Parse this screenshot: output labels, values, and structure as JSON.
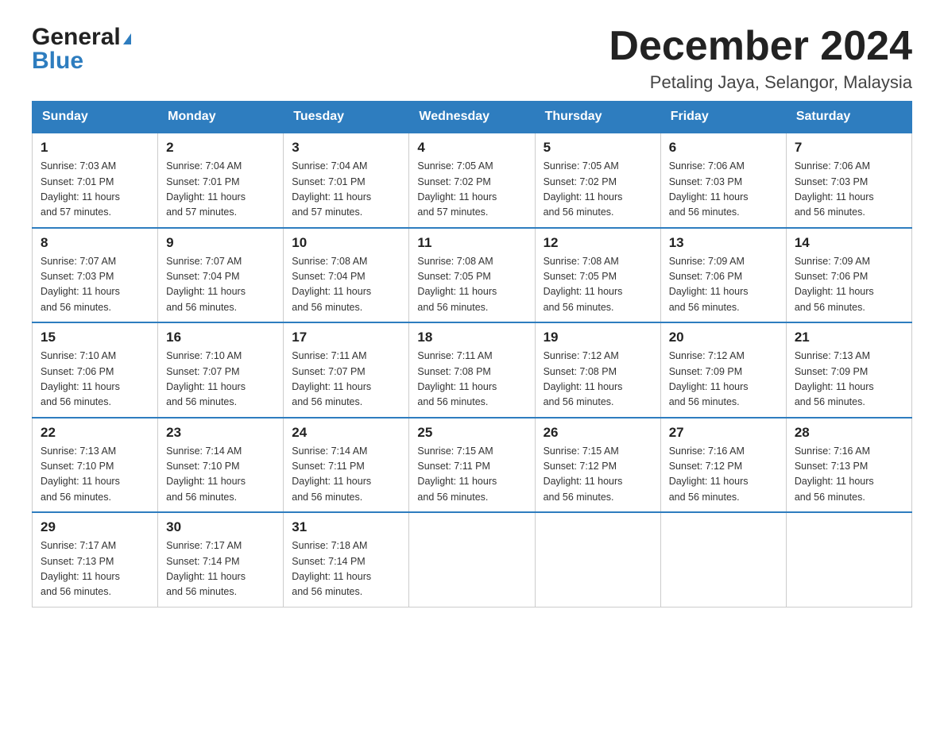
{
  "header": {
    "logo_general": "General",
    "logo_blue": "Blue",
    "month_title": "December 2024",
    "location": "Petaling Jaya, Selangor, Malaysia"
  },
  "days_of_week": [
    "Sunday",
    "Monday",
    "Tuesday",
    "Wednesday",
    "Thursday",
    "Friday",
    "Saturday"
  ],
  "weeks": [
    [
      {
        "day": "1",
        "sunrise": "7:03 AM",
        "sunset": "7:01 PM",
        "daylight": "11 hours and 57 minutes."
      },
      {
        "day": "2",
        "sunrise": "7:04 AM",
        "sunset": "7:01 PM",
        "daylight": "11 hours and 57 minutes."
      },
      {
        "day": "3",
        "sunrise": "7:04 AM",
        "sunset": "7:01 PM",
        "daylight": "11 hours and 57 minutes."
      },
      {
        "day": "4",
        "sunrise": "7:05 AM",
        "sunset": "7:02 PM",
        "daylight": "11 hours and 57 minutes."
      },
      {
        "day": "5",
        "sunrise": "7:05 AM",
        "sunset": "7:02 PM",
        "daylight": "11 hours and 56 minutes."
      },
      {
        "day": "6",
        "sunrise": "7:06 AM",
        "sunset": "7:03 PM",
        "daylight": "11 hours and 56 minutes."
      },
      {
        "day": "7",
        "sunrise": "7:06 AM",
        "sunset": "7:03 PM",
        "daylight": "11 hours and 56 minutes."
      }
    ],
    [
      {
        "day": "8",
        "sunrise": "7:07 AM",
        "sunset": "7:03 PM",
        "daylight": "11 hours and 56 minutes."
      },
      {
        "day": "9",
        "sunrise": "7:07 AM",
        "sunset": "7:04 PM",
        "daylight": "11 hours and 56 minutes."
      },
      {
        "day": "10",
        "sunrise": "7:08 AM",
        "sunset": "7:04 PM",
        "daylight": "11 hours and 56 minutes."
      },
      {
        "day": "11",
        "sunrise": "7:08 AM",
        "sunset": "7:05 PM",
        "daylight": "11 hours and 56 minutes."
      },
      {
        "day": "12",
        "sunrise": "7:08 AM",
        "sunset": "7:05 PM",
        "daylight": "11 hours and 56 minutes."
      },
      {
        "day": "13",
        "sunrise": "7:09 AM",
        "sunset": "7:06 PM",
        "daylight": "11 hours and 56 minutes."
      },
      {
        "day": "14",
        "sunrise": "7:09 AM",
        "sunset": "7:06 PM",
        "daylight": "11 hours and 56 minutes."
      }
    ],
    [
      {
        "day": "15",
        "sunrise": "7:10 AM",
        "sunset": "7:06 PM",
        "daylight": "11 hours and 56 minutes."
      },
      {
        "day": "16",
        "sunrise": "7:10 AM",
        "sunset": "7:07 PM",
        "daylight": "11 hours and 56 minutes."
      },
      {
        "day": "17",
        "sunrise": "7:11 AM",
        "sunset": "7:07 PM",
        "daylight": "11 hours and 56 minutes."
      },
      {
        "day": "18",
        "sunrise": "7:11 AM",
        "sunset": "7:08 PM",
        "daylight": "11 hours and 56 minutes."
      },
      {
        "day": "19",
        "sunrise": "7:12 AM",
        "sunset": "7:08 PM",
        "daylight": "11 hours and 56 minutes."
      },
      {
        "day": "20",
        "sunrise": "7:12 AM",
        "sunset": "7:09 PM",
        "daylight": "11 hours and 56 minutes."
      },
      {
        "day": "21",
        "sunrise": "7:13 AM",
        "sunset": "7:09 PM",
        "daylight": "11 hours and 56 minutes."
      }
    ],
    [
      {
        "day": "22",
        "sunrise": "7:13 AM",
        "sunset": "7:10 PM",
        "daylight": "11 hours and 56 minutes."
      },
      {
        "day": "23",
        "sunrise": "7:14 AM",
        "sunset": "7:10 PM",
        "daylight": "11 hours and 56 minutes."
      },
      {
        "day": "24",
        "sunrise": "7:14 AM",
        "sunset": "7:11 PM",
        "daylight": "11 hours and 56 minutes."
      },
      {
        "day": "25",
        "sunrise": "7:15 AM",
        "sunset": "7:11 PM",
        "daylight": "11 hours and 56 minutes."
      },
      {
        "day": "26",
        "sunrise": "7:15 AM",
        "sunset": "7:12 PM",
        "daylight": "11 hours and 56 minutes."
      },
      {
        "day": "27",
        "sunrise": "7:16 AM",
        "sunset": "7:12 PM",
        "daylight": "11 hours and 56 minutes."
      },
      {
        "day": "28",
        "sunrise": "7:16 AM",
        "sunset": "7:13 PM",
        "daylight": "11 hours and 56 minutes."
      }
    ],
    [
      {
        "day": "29",
        "sunrise": "7:17 AM",
        "sunset": "7:13 PM",
        "daylight": "11 hours and 56 minutes."
      },
      {
        "day": "30",
        "sunrise": "7:17 AM",
        "sunset": "7:14 PM",
        "daylight": "11 hours and 56 minutes."
      },
      {
        "day": "31",
        "sunrise": "7:18 AM",
        "sunset": "7:14 PM",
        "daylight": "11 hours and 56 minutes."
      },
      null,
      null,
      null,
      null
    ]
  ]
}
